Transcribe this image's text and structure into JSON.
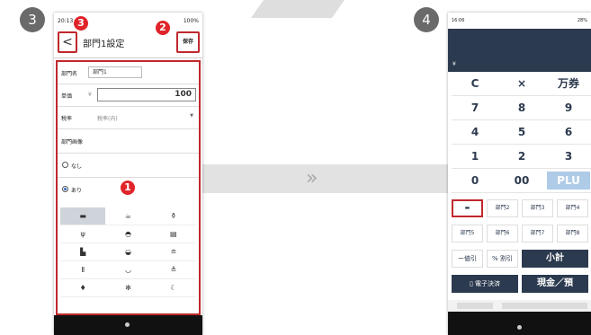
{
  "badges": {
    "step3": "3",
    "step4": "4",
    "marker1": "1",
    "marker2": "2",
    "marker3": "3"
  },
  "phone3": {
    "status": {
      "time": "20:13",
      "battery": "100%"
    },
    "header": {
      "back": "<",
      "title": "部門1設定",
      "save": "保存"
    },
    "fields": {
      "name_label": "部門名",
      "name_value": "部門1",
      "price_label": "単価",
      "currency": "¥",
      "price_value": "100",
      "tax_label": "税率",
      "tax_value": "税率(内)"
    },
    "image_label": "部門画像",
    "radio_none": "なし",
    "radio_with": "あり",
    "icons": [
      "cup-icon",
      "teapot-icon",
      "drink-icon",
      "cutlery-icon",
      "dish-icon",
      "bento-icon",
      "cake-icon",
      "bowl-icon",
      "burger-icon",
      "beer-icon",
      "rice-bowl-icon",
      "box-icon",
      "icecream-icon",
      "sparkle-icon",
      "crescent-icon"
    ]
  },
  "phone4": {
    "status": {
      "time": "16:06",
      "battery": "28%"
    },
    "currency": "¥",
    "keys": [
      [
        "C",
        "×",
        "万券"
      ],
      [
        "7",
        "8",
        "9"
      ],
      [
        "4",
        "5",
        "6"
      ],
      [
        "1",
        "2",
        "3"
      ],
      [
        "0",
        "00",
        "PLU"
      ]
    ],
    "dept_row1": {
      "d2": "部門2",
      "d3": "部門3",
      "d4": "部門4"
    },
    "dept_row2": {
      "d5": "部門5",
      "d6": "部門6",
      "d7": "部門7",
      "d8": "部門8"
    },
    "discount": "ー値引",
    "percent": "% 割引",
    "subtotal": "小計",
    "epay": "電子決済",
    "cash": "現金／預"
  }
}
